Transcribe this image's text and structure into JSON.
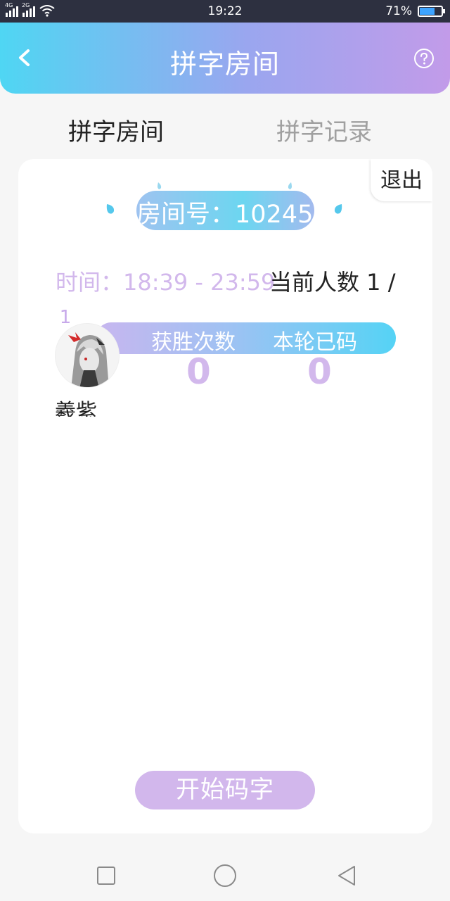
{
  "status_bar": {
    "signal1_tag": "4G",
    "signal2_tag": "2G",
    "time": "19:22",
    "battery_percent": "71%",
    "battery_level": 0.71
  },
  "header": {
    "title": "拼字房间",
    "back_icon": "chevron-left-icon",
    "help_icon": "question-circle-icon"
  },
  "tabs": [
    {
      "label": "拼字房间",
      "active": true
    },
    {
      "label": "拼字记录",
      "active": false
    }
  ],
  "room": {
    "exit_label": "退出",
    "room_number_text": "房间号：10245",
    "time_text": "时间：18:39 - 23:59",
    "player_count_text": "当前人数 1 /"
  },
  "player": {
    "rank": "1",
    "wins_label": "获胜次数",
    "typed_label": "本轮已码",
    "wins_value": "0",
    "typed_value": "0",
    "name": "羲紫"
  },
  "start_button_label": "开始码字",
  "colors": {
    "header_gradient_start": "#4fd6f3",
    "header_gradient_end": "#c29be9",
    "accent_lilac": "#d2b8ec",
    "accent_cyan": "#55d3f5"
  }
}
